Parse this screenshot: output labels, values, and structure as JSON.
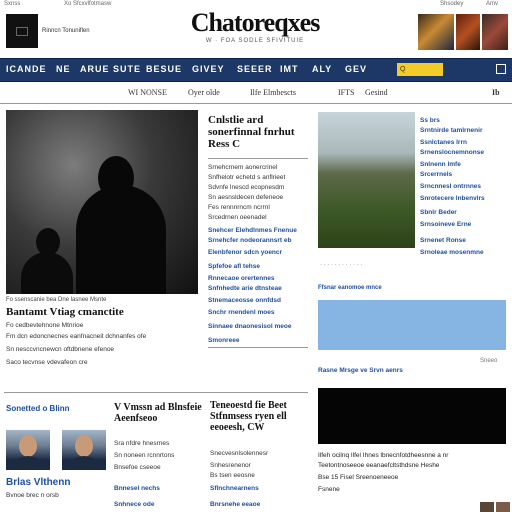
{
  "topbar": {
    "left": "Sxnss",
    "center": "Xo Sfcxvlfotmasw",
    "right_links": [
      "Shsodey",
      "Amv"
    ]
  },
  "logo": {
    "label": "Rinncn Tonuniflen"
  },
  "masthead": {
    "title": "Chatoreqxes",
    "subtitle": "W · FOA   SODLE   SFIVITUIE"
  },
  "nav": {
    "items": [
      "ICANDE",
      "NE",
      "ARUE",
      "SUTE",
      "BESUE",
      "GIVEY",
      "SEEER",
      "IMT",
      "ALY",
      "GEV"
    ],
    "search_placeholder": "Q",
    "menu_icon": "menu-icon"
  },
  "subnav": {
    "items": [
      "WI NONSE",
      "Oyer olde",
      "Ilfe Elmbescts",
      "IFTS",
      "Gesind"
    ],
    "right": "Ib"
  },
  "lead": {
    "caption": "Fo  ssenscanie  bea  Dne  lasnee  Msnte",
    "headline": "Bantamt Vtiag cmanctite",
    "lines": [
      "Fo cedbevtehnone Mtnrioe",
      "Fm dcn edoncnecnes eanfnacneit dchnanfes ofe",
      "Sn nesccvncnewcn oftdbnene efenoe",
      "Saco tecvnse vdevafeon cre"
    ]
  },
  "col2": {
    "headline": "Cnlstlie ard sonerfinnal fnrhut Ress C",
    "lines": [
      "Srnehcrnem aonercrinel",
      "Snfhelotr echetd s anflrieet",
      "Sdvnfe lnescd ecopnesdm",
      "Sn aesnsldecen defeneoe",
      "Fes rennnrncm ncrrnl",
      "Srcedrnen oeenadel"
    ],
    "links": [
      "Snehcer Elehdlnmes Fnenue",
      "Srnehcfer nodeorannsrt eb",
      "Elenbfenor sdcn yoencr",
      "Spfefoe afl tehse",
      "Rnnecaoe orertennes",
      "Snfnhedte arie dtnsteae",
      "Stnemaceosse onnfdsd",
      "Snchr rnendenl moes",
      "Sinnaee dnaonesisol meoe",
      "Smonreee"
    ]
  },
  "col3": {
    "links": [
      "Ss brs",
      "Srntnirde tamlrnenir",
      "Ssnlctanes lrrn",
      "Srnenslocnemnonse",
      "Snlnenn lmfe",
      "Srcerrnels",
      "Srncnnesl ontrnnes",
      "Snrotecere lnbenvlrs",
      "Sbnlr Beder",
      "Srnsoineve Erne",
      "Srnenet Ronse",
      "Srnoleae mosenmne"
    ],
    "blue_caption": "Ffsnar eanomoe mnce",
    "blue_footer": "Rasne Mrsge ve Srvn aenrs",
    "blue_right": "Sneeo",
    "black_lines": [
      "Ilfeh ocilnq Ilfel Ihnes lbnecnfotdheesnne a nr",
      "Teetontnoseeoe eeanaefcltsthdsne Heshe",
      "Bse     15     Fisel Sreenoeneeoe",
      "Fsnene"
    ]
  },
  "bottom": {
    "b1": {
      "headline": "Sonetted o Blinn",
      "title2": "Brlas Vlthenn",
      "sub": "Bvnoe brec n orsb"
    },
    "b2": {
      "headline": "V  Vmssn ad Blnsfeie Aeenfseoo",
      "lines": [
        "Sra nfdre hnesrnes",
        "Sn noneen rcnnrtons",
        "Bnsefoe cseeoe"
      ],
      "links": [
        "Bnnesel nechs",
        "Snhnece ode"
      ]
    },
    "b3": {
      "headline": "Teneoestd fie Beet Stfnmsess ryen ell eeoeesh, CW",
      "lines": [
        "Snecvesnlsolennesr",
        "Snhesrenenor",
        "Bs tsen eeosne"
      ],
      "links": [
        "Sflnchnearnens",
        "Bnrsnehe eeaoe"
      ]
    }
  }
}
